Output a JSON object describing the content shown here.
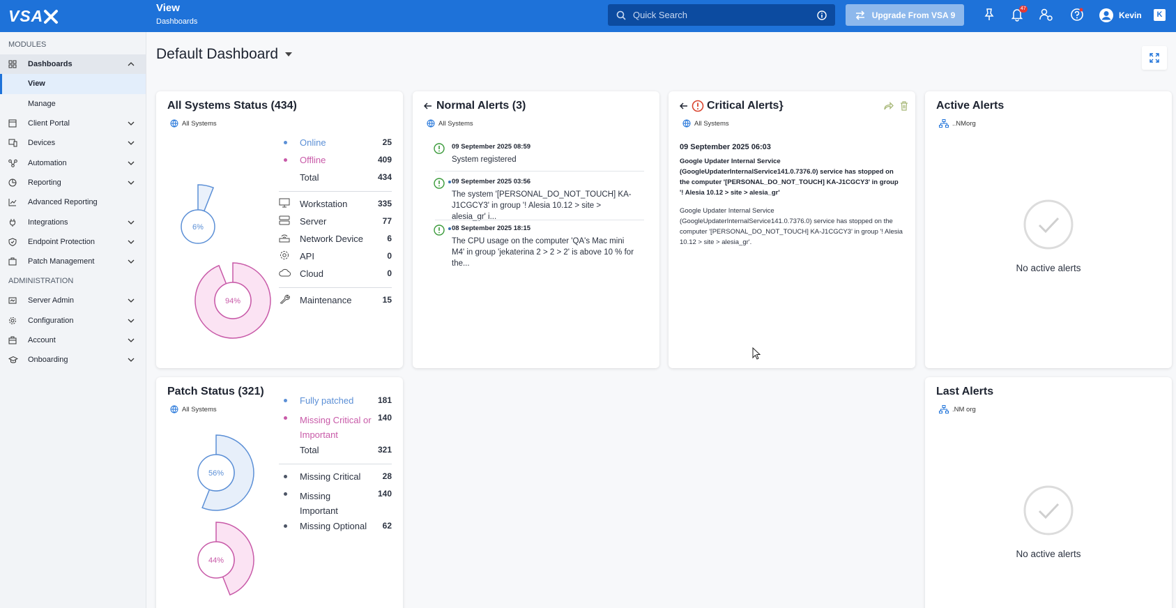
{
  "app": {
    "logo": "VSA",
    "header_title": "View",
    "header_subtitle": "Dashboards",
    "search_placeholder": "Quick Search",
    "upgrade_label": "Upgrade From VSA 9",
    "notification_count": "47",
    "user_name": "Kevin",
    "tenant_badge": "K",
    "accent_color": "#1e72d9"
  },
  "sidebar": {
    "modules_label": "MODULES",
    "admin_label": "ADMINISTRATION",
    "modules": [
      {
        "label": "Dashboards",
        "icon": "grid-icon"
      },
      {
        "label": "Client Portal",
        "icon": "portal-icon"
      },
      {
        "label": "Devices",
        "icon": "devices-icon"
      },
      {
        "label": "Automation",
        "icon": "automation-icon"
      },
      {
        "label": "Reporting",
        "icon": "pie-icon"
      },
      {
        "label": "Advanced Reporting",
        "icon": "line-chart-icon"
      },
      {
        "label": "Integrations",
        "icon": "plug-icon"
      },
      {
        "label": "Endpoint Protection",
        "icon": "shield-icon"
      },
      {
        "label": "Patch Management",
        "icon": "patch-icon"
      }
    ],
    "dashboards_sub": [
      "View",
      "Manage"
    ],
    "admin": [
      {
        "label": "Server Admin",
        "icon": "server-admin-icon"
      },
      {
        "label": "Configuration",
        "icon": "gear-icon"
      },
      {
        "label": "Account",
        "icon": "account-icon"
      },
      {
        "label": "Onboarding",
        "icon": "graduation-icon"
      }
    ]
  },
  "main": {
    "dashboard_name": "Default Dashboard"
  },
  "systems_status": {
    "title": "All Systems Status (434)",
    "scope": "All Systems",
    "donut_small_pct": "6%",
    "donut_large_pct": "94%",
    "online_fraction": 0.06,
    "offline_fraction": 0.94,
    "rows": [
      {
        "label": "Online",
        "value": "25"
      },
      {
        "label": "Offline",
        "value": "409"
      },
      {
        "label": "Total",
        "value": "434"
      }
    ],
    "types": [
      {
        "label": "Workstation",
        "value": "335",
        "icon": "monitor-icon"
      },
      {
        "label": "Server",
        "value": "77",
        "icon": "server-icon"
      },
      {
        "label": "Network Device",
        "value": "6",
        "icon": "router-icon"
      },
      {
        "label": "API",
        "value": "0",
        "icon": "gear-icon"
      },
      {
        "label": "Cloud",
        "value": "0",
        "icon": "cloud-icon"
      }
    ],
    "maintenance": {
      "label": "Maintenance",
      "value": "15",
      "icon": "wrench-icon"
    },
    "online_color": "#5b8fd6",
    "offline_color": "#c85aa8"
  },
  "normal_alerts": {
    "title": "Normal Alerts (3)",
    "scope": "All Systems",
    "items": [
      {
        "date": "09 September 2025 08:59",
        "message": "System registered"
      },
      {
        "date": "09 September 2025 03:56",
        "message": "The system '[PERSONAL_DO_NOT_TOUCH] KA-J1CGCY3' in group '! Alesia 10.12 > site > alesia_gr' i..."
      },
      {
        "date": "08 September 2025 18:15",
        "message": "The CPU usage on the computer 'QA's Mac mini M4' in group 'jekaterina 2 > 2 > 2' is above 10 % for the..."
      }
    ]
  },
  "critical_alerts": {
    "title": "Critical Alerts}",
    "scope": "All Systems",
    "date": "09 September 2025 06:03",
    "bold_message": "Google Updater Internal Service (GoogleUpdaterInternalService141.0.7376.0) service has stopped on the computer '[PERSONAL_DO_NOT_TOUCH] KA-J1CGCY3' in group '! Alesia 10.12 > site > alesia_gr'",
    "message": "Google Updater Internal Service (GoogleUpdaterInternalService141.0.7376.0) service has stopped on the computer '[PERSONAL_DO_NOT_TOUCH] KA-J1CGCY3' in group '! Alesia 10.12 > site > alesia_gr'."
  },
  "active_alerts": {
    "title": "Active Alerts",
    "scope": "..NMorg",
    "empty": "No active alerts"
  },
  "patch_status": {
    "title": "Patch Status (321)",
    "scope": "All Systems",
    "donut_top_pct": "56%",
    "donut_bottom_pct": "44%",
    "patched_fraction": 0.56,
    "missing_fraction": 0.44,
    "rows": [
      {
        "label": "Fully patched",
        "value": "181"
      },
      {
        "label": "Missing Critical or Important",
        "value": "140"
      },
      {
        "label": "Total",
        "value": "321"
      }
    ],
    "details": [
      {
        "label": "Missing Critical",
        "value": "28"
      },
      {
        "label": "Missing Important",
        "value": "140"
      },
      {
        "label": "Missing Optional",
        "value": "62"
      }
    ]
  },
  "last_alerts": {
    "title": "Last Alerts",
    "scope": ".NM org",
    "empty": "No active alerts"
  }
}
